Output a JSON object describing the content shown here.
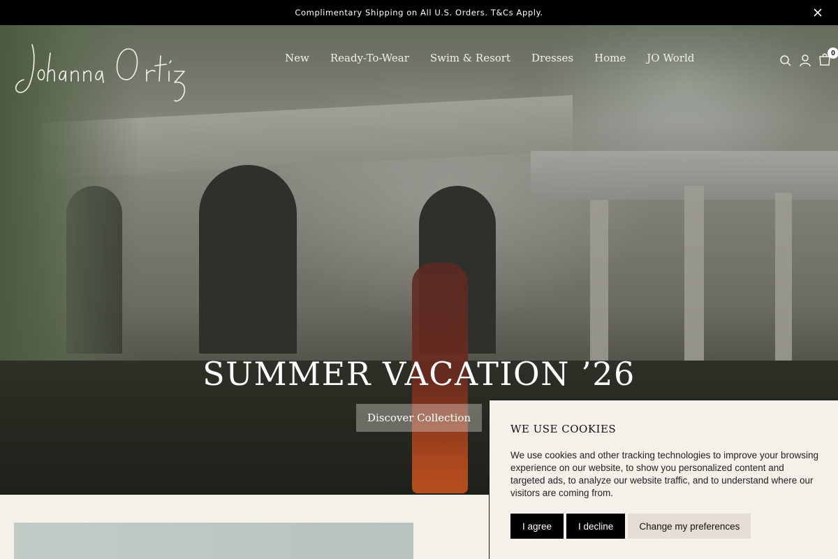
{
  "announcement": {
    "text": "Complimentary Shipping on All U.S. Orders. T&Cs Apply.",
    "close_icon": "close-icon"
  },
  "brand": {
    "logo_text": "Johanna Ortiz"
  },
  "nav": {
    "items": [
      {
        "label": "New"
      },
      {
        "label": "Ready-To-Wear"
      },
      {
        "label": "Swim & Resort"
      },
      {
        "label": "Dresses"
      },
      {
        "label": "Home"
      },
      {
        "label": "JO World"
      }
    ]
  },
  "header_icons": {
    "search": "search-icon",
    "account": "user-icon",
    "cart": "shopping-bag-icon",
    "cart_count": "0"
  },
  "hero": {
    "title": "SUMMER VACATION ’26",
    "cta_label": "Discover Collection"
  },
  "cookie_banner": {
    "title": "WE USE COOKIES",
    "body": "We use cookies and other tracking technologies to improve your browsing experience on our website, to show you personalized content and targeted ads, to analyze our website traffic, and to understand where our visitors are coming from.",
    "agree_label": "I agree",
    "decline_label": "I decline",
    "preferences_label": "Change my preferences"
  },
  "colors": {
    "announcement_bg": "#000000",
    "page_bg": "#f4f0ea",
    "button_dark": "#000000",
    "button_light": "#e4ded5"
  }
}
